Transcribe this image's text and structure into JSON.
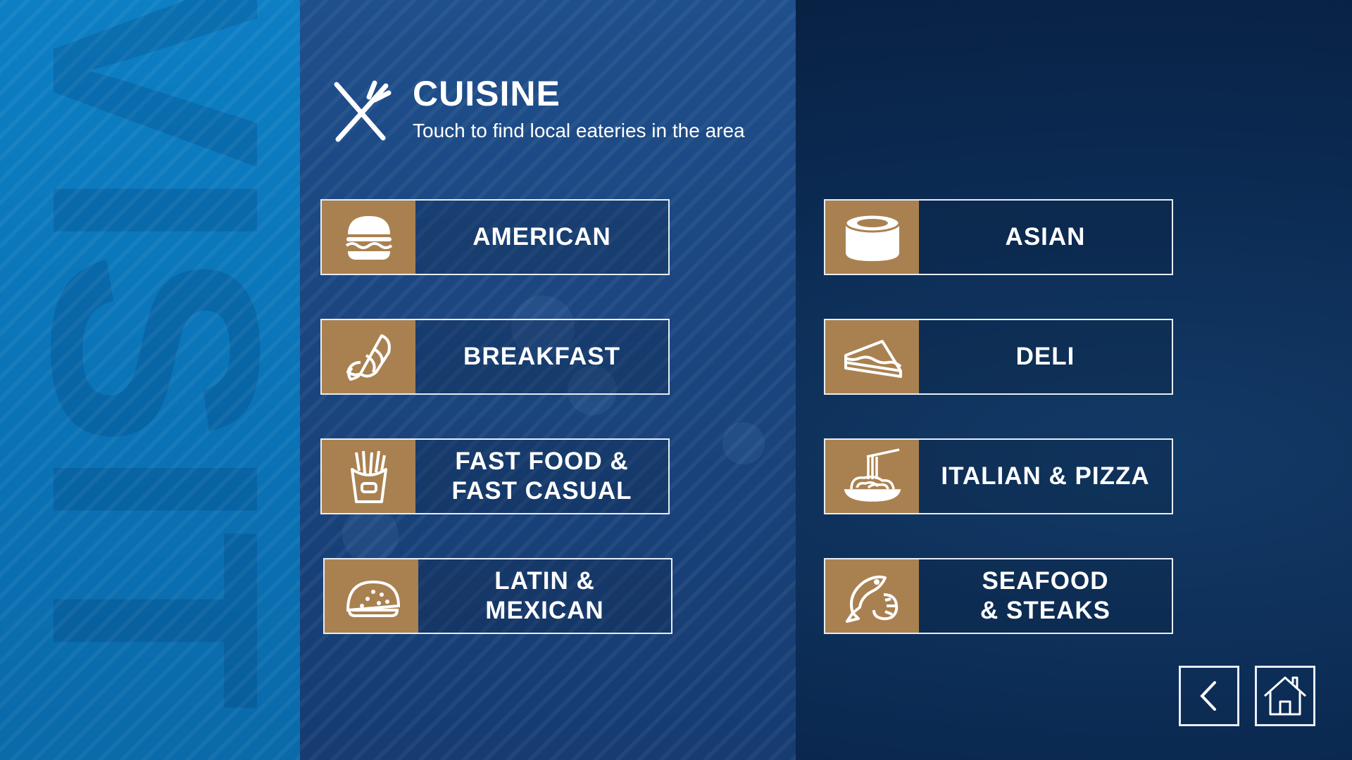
{
  "background": {
    "watermark_text": "VISIT"
  },
  "header": {
    "icon": "fork-knife-icon",
    "title": "CUISINE",
    "subtitle": "Touch to find local eateries in the area"
  },
  "categories": [
    {
      "label": "AMERICAN",
      "icon": "burger-icon"
    },
    {
      "label": "BREAKFAST",
      "icon": "croissant-icon"
    },
    {
      "label": "FAST FOOD &\nFAST CASUAL",
      "icon": "fries-icon"
    },
    {
      "label": "LATIN &\nMEXICAN",
      "icon": "taco-icon"
    },
    {
      "label": "ASIAN",
      "icon": "sushi-icon"
    },
    {
      "label": "DELI",
      "icon": "sandwich-icon"
    },
    {
      "label": "ITALIAN & PIZZA",
      "icon": "pasta-icon"
    },
    {
      "label": "SEAFOOD\n& STEAKS",
      "icon": "fish-shrimp-icon"
    }
  ],
  "nav": {
    "back_icon": "chevron-left-icon",
    "home_icon": "home-icon"
  },
  "colors": {
    "accent": "#a98150",
    "left_band": "#0d7fc4",
    "middle_band": "#1f4f8c",
    "border": "#e7edf5"
  }
}
